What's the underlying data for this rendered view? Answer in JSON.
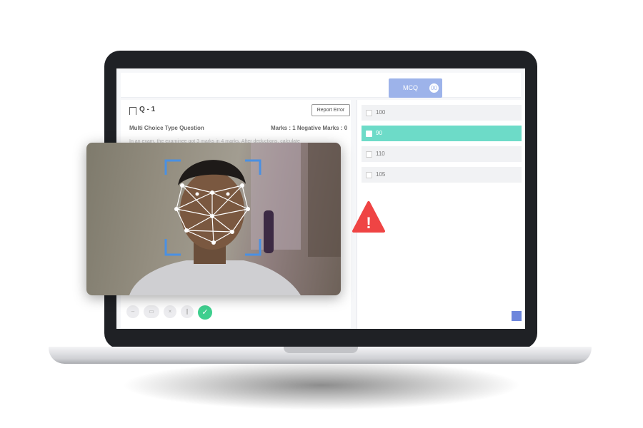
{
  "header": {
    "tab_label": "MCQ",
    "tab_badge": "00"
  },
  "question": {
    "number_label": "Q - 1",
    "report_button": "Report Error",
    "type": "Multi Choice Type Question",
    "marks": "Marks : 1   Negative Marks : 0",
    "text": "In an exam, the examinee got 3 marks in 4 marks. After deductions, calculate"
  },
  "options": [
    {
      "label": "100",
      "selected": false
    },
    {
      "label": "90",
      "selected": true
    },
    {
      "label": "110",
      "selected": false
    },
    {
      "label": "105",
      "selected": false
    }
  ],
  "toolbar": {
    "submit_icon": "✓"
  },
  "proctoring": {
    "alert_icon": "!",
    "colors": {
      "frame": "#4a90e2",
      "alert": "#ef4444",
      "wave_start": "#4f6ad8",
      "wave_end": "#d84fb8",
      "selected_option": "#6ddbc8"
    }
  }
}
